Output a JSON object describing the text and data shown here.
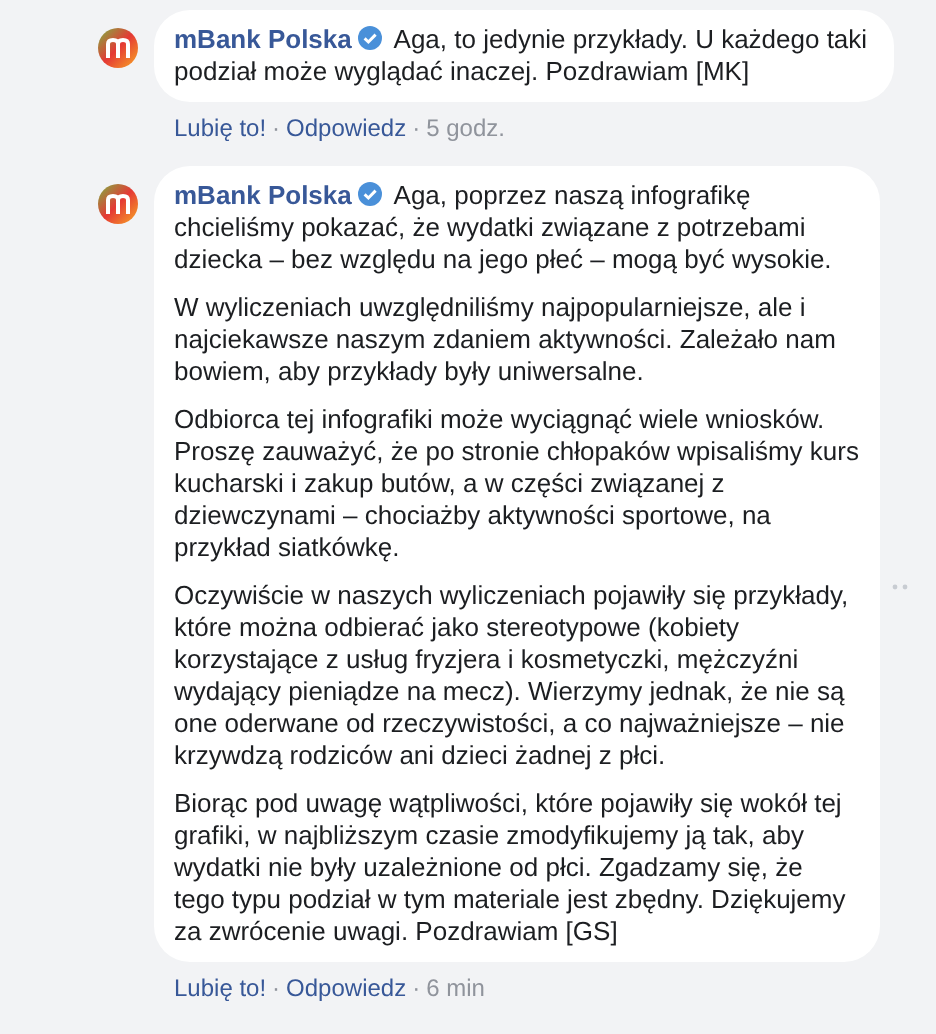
{
  "comments": [
    {
      "author": "mBank Polska",
      "verified": true,
      "paragraphs": [
        "Aga, to jedynie przykłady. U każdego taki podział może wyglądać inaczej. Pozdrawiam [MK]"
      ],
      "actions": {
        "like": "Lubię to!",
        "separator": "·",
        "reply": "Odpowiedz",
        "time": "5 godz."
      },
      "options": false
    },
    {
      "author": "mBank Polska",
      "verified": true,
      "paragraphs": [
        "Aga, poprzez naszą infografikę chcieliśmy pokazać, że wydatki związane z potrzebami dziecka – bez względu na jego płeć – mogą być wysokie.",
        "W wyliczeniach uwzględniliśmy najpopularniejsze, ale i najciekawsze naszym zdaniem aktywności. Zależało nam bowiem, aby przykłady były uniwersalne.",
        "Odbiorca tej infografiki może wyciągnąć wiele wniosków. Proszę zauważyć, że po stronie chłopaków wpisaliśmy kurs kucharski i zakup butów, a w części związanej z dziewczynami – chociażby aktywności sportowe, na przykład siatkówkę.",
        "Oczywiście w naszych wyliczeniach pojawiły się przykłady, które można odbierać jako stereotypowe (kobiety korzystające z usług fryzjera i kosmetyczki, mężczyźni wydający pieniądze na mecz). Wierzymy jednak, że nie są one oderwane od rzeczywistości, a co najważniejsze – nie krzywdzą rodziców ani dzieci żadnej z płci.",
        "Biorąc pod uwagę wątpliwości, które pojawiły się wokół tej grafiki, w najbliższym czasie zmodyfikujemy ją tak, aby wydatki nie były uzależnione od płci. Zgadzamy się, że tego typu podział w tym materiale jest zbędny. Dziękujemy za zwrócenie uwagi. Pozdrawiam [GS]"
      ],
      "actions": {
        "like": "Lubię to!",
        "separator": "·",
        "reply": "Odpowiedz",
        "time": "6 min"
      },
      "options": true
    }
  ]
}
